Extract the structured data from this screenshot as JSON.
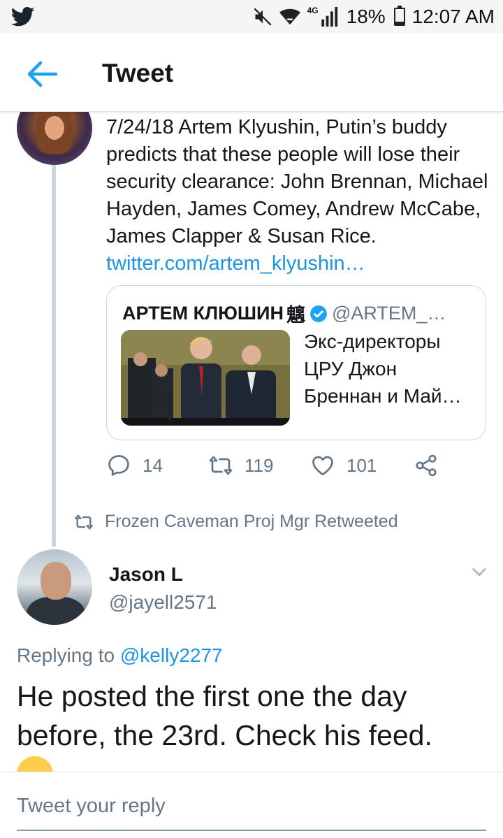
{
  "status_bar": {
    "battery_percent": "18%",
    "battery_level": 0.18,
    "time": "12:07 AM",
    "network": "4G",
    "icons": [
      "twitter-bird-icon",
      "mute-icon",
      "wifi-icon",
      "signal-icon",
      "battery-icon"
    ]
  },
  "app_bar": {
    "title": "Tweet",
    "back_icon": "arrow-left-icon"
  },
  "tweet": {
    "text": "7/24/18 Artem Klyushin, Putin’s buddy predicts that these people will lose their security clearance: John Brennan, Michael Hayden, James Comey, Andrew McCabe, James Clapper & Susan Rice.",
    "link": "twitter.com/artem_klyushin…",
    "quote": {
      "name": "АРТЕМ КЛЮШИН",
      "name_glyph": "魑",
      "handle": "@ARTEM_…",
      "text": "Экс-директоры ЦРУ Джон Бреннан и Май…"
    },
    "actions": {
      "replies": "14",
      "retweets": "119",
      "likes": "101"
    },
    "retweeted_by": "Frozen Caveman Proj Mgr Retweeted"
  },
  "reply": {
    "name": "Jason L",
    "handle": "@jayell2571",
    "replying_prefix": "Replying to",
    "replying_to": "@kelly2277",
    "text": "He posted the first one the day before, the 23rd.  Check his feed."
  },
  "composer": {
    "placeholder": "Tweet your reply"
  },
  "colors": {
    "accent": "#1b95e0",
    "secondary_text": "#657786",
    "border": "#ccd6dd"
  }
}
